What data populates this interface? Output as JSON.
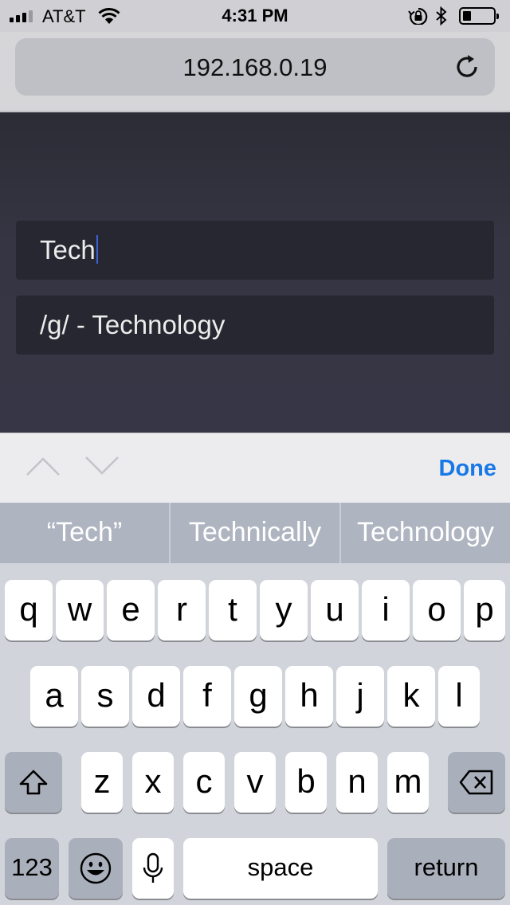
{
  "status_bar": {
    "carrier": "AT&T",
    "time": "4:31 PM",
    "icons": [
      "signal-icon",
      "wifi-icon",
      "rotation-lock-icon",
      "bluetooth-icon",
      "battery-icon"
    ]
  },
  "browser": {
    "url": "192.168.0.19",
    "reload_icon": "reload-icon"
  },
  "page": {
    "input_value": "Tech",
    "suggestion": "/g/ - Technology"
  },
  "accessory": {
    "prev_icon": "chevron-up-icon",
    "next_icon": "chevron-down-icon",
    "done_label": "Done"
  },
  "predictive": [
    "“Tech”",
    "Technically",
    "Technology"
  ],
  "keyboard": {
    "row1": [
      "q",
      "w",
      "e",
      "r",
      "t",
      "y",
      "u",
      "i",
      "o",
      "p"
    ],
    "row2": [
      "a",
      "s",
      "d",
      "f",
      "g",
      "h",
      "j",
      "k",
      "l"
    ],
    "row3": [
      "z",
      "x",
      "c",
      "v",
      "b",
      "n",
      "m"
    ],
    "numbers_label": "123",
    "space_label": "space",
    "return_label": "return",
    "shift_icon": "shift-icon",
    "delete_icon": "delete-icon",
    "emoji_icon": "emoji-icon",
    "mic_icon": "microphone-icon"
  },
  "colors": {
    "accent": "#1778e6",
    "page_bg": "#353543",
    "field_bg": "#272731"
  }
}
